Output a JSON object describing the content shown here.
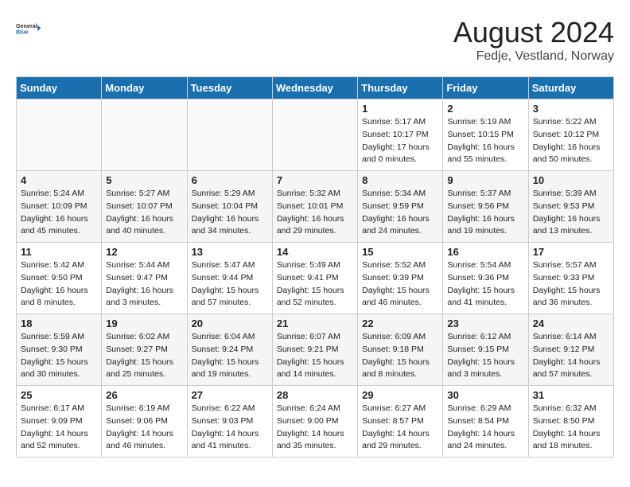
{
  "header": {
    "logo_line1": "General",
    "logo_line2": "Blue",
    "month_year": "August 2024",
    "location": "Fedje, Vestland, Norway"
  },
  "days_of_week": [
    "Sunday",
    "Monday",
    "Tuesday",
    "Wednesday",
    "Thursday",
    "Friday",
    "Saturday"
  ],
  "weeks": [
    [
      {
        "day": "",
        "detail": ""
      },
      {
        "day": "",
        "detail": ""
      },
      {
        "day": "",
        "detail": ""
      },
      {
        "day": "",
        "detail": ""
      },
      {
        "day": "1",
        "detail": "Sunrise: 5:17 AM\nSunset: 10:17 PM\nDaylight: 17 hours\nand 0 minutes."
      },
      {
        "day": "2",
        "detail": "Sunrise: 5:19 AM\nSunset: 10:15 PM\nDaylight: 16 hours\nand 55 minutes."
      },
      {
        "day": "3",
        "detail": "Sunrise: 5:22 AM\nSunset: 10:12 PM\nDaylight: 16 hours\nand 50 minutes."
      }
    ],
    [
      {
        "day": "4",
        "detail": "Sunrise: 5:24 AM\nSunset: 10:09 PM\nDaylight: 16 hours\nand 45 minutes."
      },
      {
        "day": "5",
        "detail": "Sunrise: 5:27 AM\nSunset: 10:07 PM\nDaylight: 16 hours\nand 40 minutes."
      },
      {
        "day": "6",
        "detail": "Sunrise: 5:29 AM\nSunset: 10:04 PM\nDaylight: 16 hours\nand 34 minutes."
      },
      {
        "day": "7",
        "detail": "Sunrise: 5:32 AM\nSunset: 10:01 PM\nDaylight: 16 hours\nand 29 minutes."
      },
      {
        "day": "8",
        "detail": "Sunrise: 5:34 AM\nSunset: 9:59 PM\nDaylight: 16 hours\nand 24 minutes."
      },
      {
        "day": "9",
        "detail": "Sunrise: 5:37 AM\nSunset: 9:56 PM\nDaylight: 16 hours\nand 19 minutes."
      },
      {
        "day": "10",
        "detail": "Sunrise: 5:39 AM\nSunset: 9:53 PM\nDaylight: 16 hours\nand 13 minutes."
      }
    ],
    [
      {
        "day": "11",
        "detail": "Sunrise: 5:42 AM\nSunset: 9:50 PM\nDaylight: 16 hours\nand 8 minutes."
      },
      {
        "day": "12",
        "detail": "Sunrise: 5:44 AM\nSunset: 9:47 PM\nDaylight: 16 hours\nand 3 minutes."
      },
      {
        "day": "13",
        "detail": "Sunrise: 5:47 AM\nSunset: 9:44 PM\nDaylight: 15 hours\nand 57 minutes."
      },
      {
        "day": "14",
        "detail": "Sunrise: 5:49 AM\nSunset: 9:41 PM\nDaylight: 15 hours\nand 52 minutes."
      },
      {
        "day": "15",
        "detail": "Sunrise: 5:52 AM\nSunset: 9:39 PM\nDaylight: 15 hours\nand 46 minutes."
      },
      {
        "day": "16",
        "detail": "Sunrise: 5:54 AM\nSunset: 9:36 PM\nDaylight: 15 hours\nand 41 minutes."
      },
      {
        "day": "17",
        "detail": "Sunrise: 5:57 AM\nSunset: 9:33 PM\nDaylight: 15 hours\nand 36 minutes."
      }
    ],
    [
      {
        "day": "18",
        "detail": "Sunrise: 5:59 AM\nSunset: 9:30 PM\nDaylight: 15 hours\nand 30 minutes."
      },
      {
        "day": "19",
        "detail": "Sunrise: 6:02 AM\nSunset: 9:27 PM\nDaylight: 15 hours\nand 25 minutes."
      },
      {
        "day": "20",
        "detail": "Sunrise: 6:04 AM\nSunset: 9:24 PM\nDaylight: 15 hours\nand 19 minutes."
      },
      {
        "day": "21",
        "detail": "Sunrise: 6:07 AM\nSunset: 9:21 PM\nDaylight: 15 hours\nand 14 minutes."
      },
      {
        "day": "22",
        "detail": "Sunrise: 6:09 AM\nSunset: 9:18 PM\nDaylight: 15 hours\nand 8 minutes."
      },
      {
        "day": "23",
        "detail": "Sunrise: 6:12 AM\nSunset: 9:15 PM\nDaylight: 15 hours\nand 3 minutes."
      },
      {
        "day": "24",
        "detail": "Sunrise: 6:14 AM\nSunset: 9:12 PM\nDaylight: 14 hours\nand 57 minutes."
      }
    ],
    [
      {
        "day": "25",
        "detail": "Sunrise: 6:17 AM\nSunset: 9:09 PM\nDaylight: 14 hours\nand 52 minutes."
      },
      {
        "day": "26",
        "detail": "Sunrise: 6:19 AM\nSunset: 9:06 PM\nDaylight: 14 hours\nand 46 minutes."
      },
      {
        "day": "27",
        "detail": "Sunrise: 6:22 AM\nSunset: 9:03 PM\nDaylight: 14 hours\nand 41 minutes."
      },
      {
        "day": "28",
        "detail": "Sunrise: 6:24 AM\nSunset: 9:00 PM\nDaylight: 14 hours\nand 35 minutes."
      },
      {
        "day": "29",
        "detail": "Sunrise: 6:27 AM\nSunset: 8:57 PM\nDaylight: 14 hours\nand 29 minutes."
      },
      {
        "day": "30",
        "detail": "Sunrise: 6:29 AM\nSunset: 8:54 PM\nDaylight: 14 hours\nand 24 minutes."
      },
      {
        "day": "31",
        "detail": "Sunrise: 6:32 AM\nSunset: 8:50 PM\nDaylight: 14 hours\nand 18 minutes."
      }
    ]
  ]
}
